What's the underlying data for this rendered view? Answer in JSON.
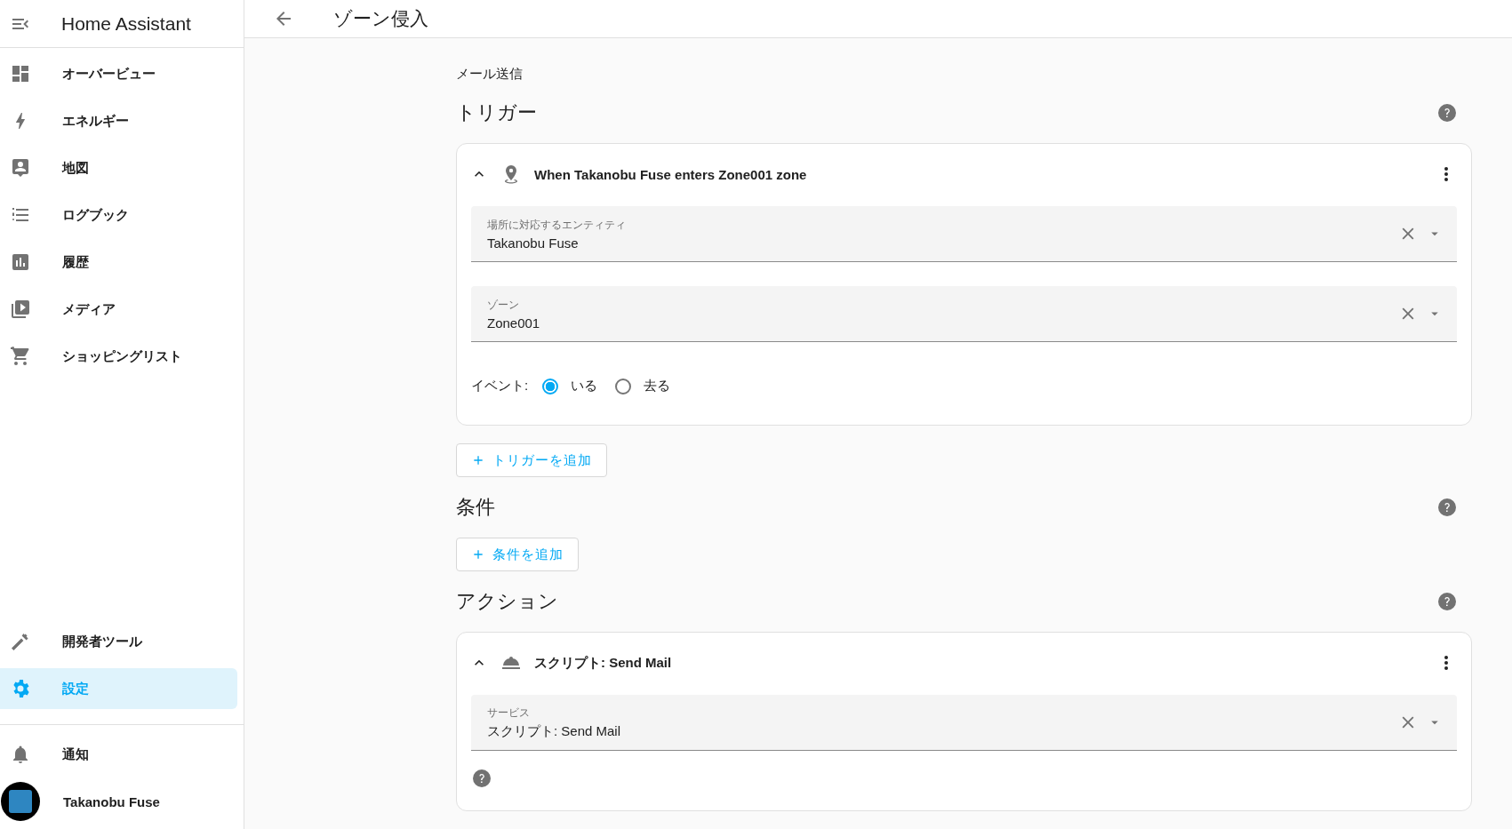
{
  "sidebar": {
    "title": "Home Assistant",
    "items": [
      {
        "label": "オーバービュー",
        "selected": false
      },
      {
        "label": "エネルギー",
        "selected": false
      },
      {
        "label": "地図",
        "selected": false
      },
      {
        "label": "ログブック",
        "selected": false
      },
      {
        "label": "履歴",
        "selected": false
      },
      {
        "label": "メディア",
        "selected": false
      },
      {
        "label": "ショッピングリスト",
        "selected": false
      }
    ],
    "bottom_items": [
      {
        "label": "開発者ツール",
        "selected": false
      },
      {
        "label": "設定",
        "selected": true
      }
    ],
    "notifications": {
      "label": "通知"
    },
    "user": {
      "name": "Takanobu Fuse"
    }
  },
  "header": {
    "title": "ゾーン侵入"
  },
  "automation": {
    "alias": "メール送信",
    "sections": [
      {
        "title": "トリガー",
        "cards": [
          {
            "kind": "zone",
            "title": "When Takanobu Fuse enters Zone001 zone",
            "expanded": true,
            "fields": [
              {
                "label": "場所に対応するエンティティ",
                "value": "Takanobu Fuse"
              },
              {
                "label": "ゾーン",
                "value": "Zone001"
              }
            ],
            "radio_group": {
              "label": "イベント:",
              "options": [
                {
                  "label": "いる",
                  "selected": true
                },
                {
                  "label": "去る",
                  "selected": false
                }
              ]
            }
          }
        ],
        "add_button": "トリガーを追加"
      },
      {
        "title": "条件",
        "add_button": "条件を追加"
      },
      {
        "title": "アクション",
        "cards": [
          {
            "kind": "service",
            "title": "スクリプト: Send Mail",
            "expanded": true,
            "fields": [
              {
                "label": "サービス",
                "value": "スクリプト: Send Mail"
              }
            ]
          }
        ]
      }
    ]
  }
}
